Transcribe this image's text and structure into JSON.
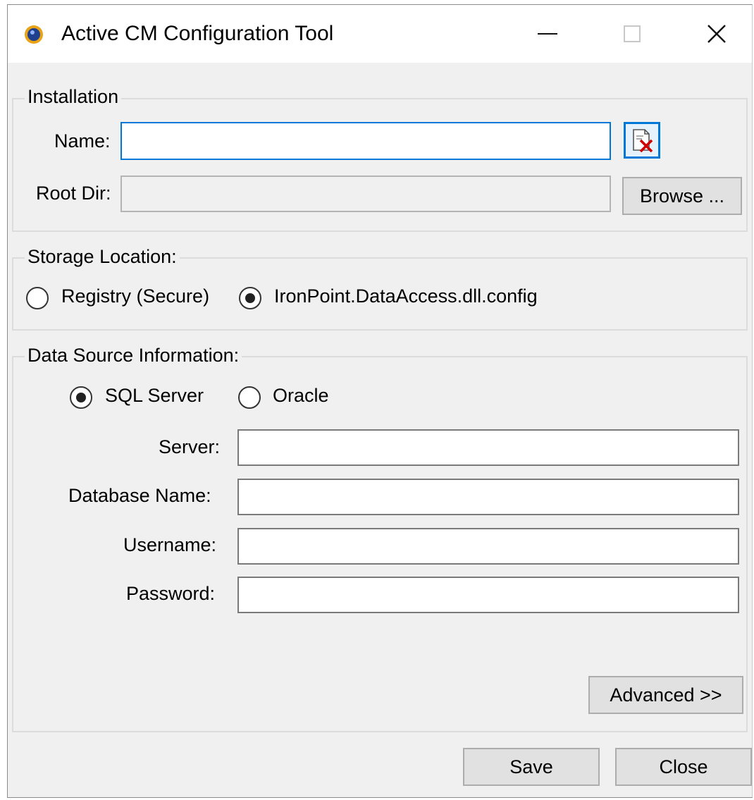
{
  "window": {
    "title": "Active CM Configuration Tool",
    "icon": "app-logo-icon",
    "controls": {
      "minimize": "minimize-icon",
      "maximize": "maximize-icon",
      "close": "close-icon"
    }
  },
  "installation": {
    "group_label": "Installation",
    "name_label": "Name:",
    "name_value": "",
    "clear_icon": "clear-document-icon",
    "root_dir_label": "Root Dir:",
    "root_dir_value": "",
    "browse_label": "Browse ..."
  },
  "storage": {
    "group_label": "Storage Location:",
    "options": [
      {
        "label": "Registry (Secure)",
        "selected": false
      },
      {
        "label": "IronPoint.DataAccess.dll.config",
        "selected": true
      }
    ]
  },
  "datasource": {
    "group_label": "Data Source Information:",
    "types": [
      {
        "label": "SQL Server",
        "selected": true
      },
      {
        "label": "Oracle",
        "selected": false
      }
    ],
    "fields": {
      "server_label": "Server:",
      "server_value": "",
      "database_label": "Database Name:",
      "database_value": "",
      "username_label": "Username:",
      "username_value": "",
      "password_label": "Password:",
      "password_value": ""
    },
    "advanced_label": "Advanced >>"
  },
  "footer": {
    "save_label": "Save",
    "close_label": "Close"
  },
  "colors": {
    "window_bg": "#f0f0f0",
    "focus_accent": "#0078d7",
    "button_bg": "#e1e1e1"
  }
}
